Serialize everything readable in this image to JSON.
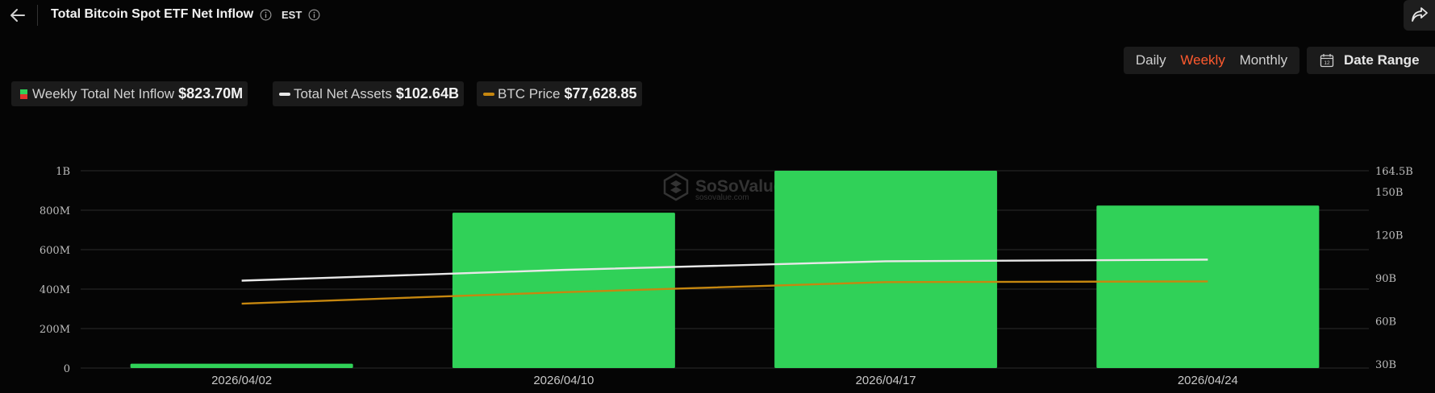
{
  "header": {
    "title": "Total Bitcoin Spot ETF Net Inflow",
    "timezone": "EST"
  },
  "controls": {
    "periods": [
      "Daily",
      "Weekly",
      "Monthly"
    ],
    "active_period": "Weekly",
    "date_range_label": "Date Range",
    "calendar_day": "12"
  },
  "watermark": {
    "brand": "SoSoValue",
    "domain": "sosovalue.com"
  },
  "legend": [
    {
      "label": "Weekly Total Net Inflow",
      "value": "$823.70M"
    },
    {
      "label": "Total Net Assets",
      "value": "$102.64B"
    },
    {
      "label": "BTC Price",
      "value": "$77,628.85"
    }
  ],
  "colors": {
    "inflow_positive": "#30d158",
    "inflow_negative": "#e0342c",
    "net_assets_line": "#e8e8e8",
    "btc_price_line": "#c6870f",
    "active_accent": "#ff5a2e",
    "gridline": "#2a2a2a"
  },
  "chart_data": {
    "type": "bar",
    "categories": [
      "2026/04/02",
      "2026/04/10",
      "2026/04/17",
      "2026/04/24"
    ],
    "left_axis": {
      "ticks": [
        0,
        200000000,
        400000000,
        600000000,
        800000000,
        1000000000
      ],
      "tick_labels": [
        "0",
        "200M",
        "400M",
        "600M",
        "800M",
        "1B"
      ],
      "ylim": [
        0,
        1000000000
      ]
    },
    "right_axis": {
      "ticks": [
        30,
        60,
        90,
        120,
        150,
        164.5
      ],
      "tick_labels": [
        "30B",
        "60B",
        "90B",
        "120B",
        "150B",
        "164.5B"
      ],
      "ylim": [
        30,
        164.5
      ],
      "unit": "B"
    },
    "series": [
      {
        "name": "Weekly Total Net Inflow",
        "type": "bar",
        "axis": "left",
        "values": [
          22000000,
          787000000,
          1000000000,
          823700000
        ]
      },
      {
        "name": "Total Net Assets",
        "type": "line",
        "axis": "right",
        "values": [
          88,
          95.5,
          101.5,
          102.64
        ]
      },
      {
        "name": "BTC Price",
        "type": "line",
        "axis": "right",
        "values": [
          72,
          80,
          87,
          87.5
        ]
      }
    ],
    "grid": true,
    "legend_position": "top-left"
  }
}
